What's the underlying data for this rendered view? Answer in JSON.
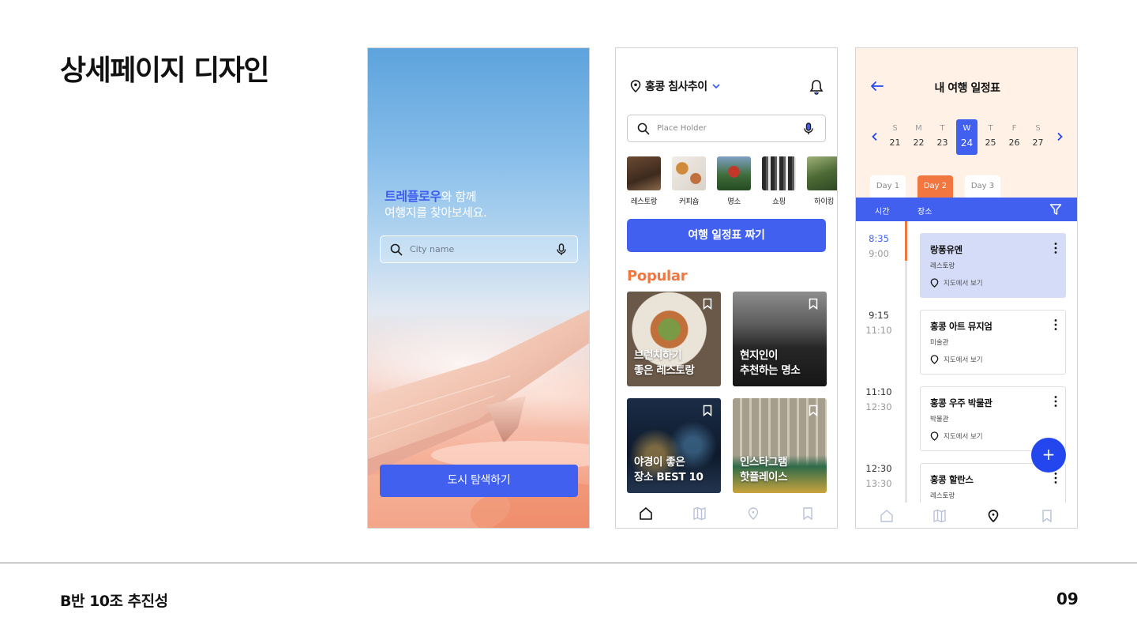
{
  "slide": {
    "title": "상세페이지 디자인",
    "team": "B반 10조 추진성",
    "page_number": "09"
  },
  "splash": {
    "brand": "트레플로우",
    "headline_rest": "와 함께",
    "headline_line2": "여행지를 찾아보세요.",
    "search_placeholder": "City name",
    "cta": "도시 탐색하기"
  },
  "home": {
    "location": "홍콩 침사추이",
    "search_placeholder": "Place Holder",
    "categories": [
      "레스토랑",
      "커피숍",
      "명소",
      "쇼핑",
      "하이킹"
    ],
    "cta": "여행 일정표 짜기",
    "popular_heading": "Popular",
    "cards": [
      {
        "line1": "브런치하기",
        "line2": "좋은 레스토랑"
      },
      {
        "line1": "현지인이",
        "line2": "추천하는 명소"
      },
      {
        "line1": "야경이 좋은",
        "line2": "장소 BEST 10"
      },
      {
        "line1": "인스타그램",
        "line2": "핫플레이스"
      }
    ]
  },
  "schedule": {
    "title": "내 여행 일정표",
    "week": [
      {
        "d": "S",
        "n": "21"
      },
      {
        "d": "M",
        "n": "22"
      },
      {
        "d": "T",
        "n": "23"
      },
      {
        "d": "W",
        "n": "24",
        "selected": true
      },
      {
        "d": "T",
        "n": "25"
      },
      {
        "d": "F",
        "n": "26"
      },
      {
        "d": "S",
        "n": "27"
      }
    ],
    "tabs": [
      "Day 1",
      "Day 2",
      "Day 3"
    ],
    "active_tab": "Day 2",
    "header_time": "시간",
    "header_place": "장소",
    "map_link": "지도에서 보기",
    "items": [
      {
        "start": "8:35",
        "end": "9:00",
        "name": "랑퐁유엔",
        "type": "레스토랑",
        "current": true
      },
      {
        "start": "9:15",
        "end": "11:10",
        "name": "홍콩 아트 뮤지엄",
        "type": "미술관"
      },
      {
        "start": "11:10",
        "end": "12:30",
        "name": "홍콩 우주 박물관",
        "type": "박물관"
      },
      {
        "start": "12:30",
        "end": "13:30",
        "name": "홍콩 할란스",
        "type": "레스토랑"
      }
    ],
    "fab": "+"
  },
  "colors": {
    "primary": "#4260ef",
    "accent": "#f2763f",
    "schedule_header_bg": "#fff1e5"
  }
}
